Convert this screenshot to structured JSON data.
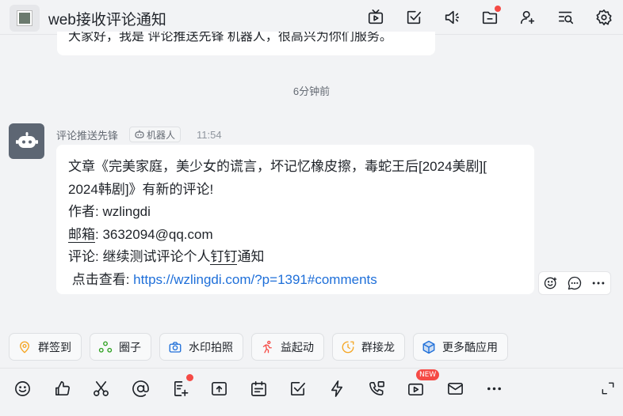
{
  "header": {
    "title": "web接收评论通知",
    "icons": [
      "live-icon",
      "todo-icon",
      "announce-icon",
      "folder-icon",
      "add-member-icon",
      "search-history-icon",
      "settings-icon"
    ]
  },
  "prev_message": {
    "text": "大家好，我是 评论推送先锋 机器人，很高兴为你们服务。"
  },
  "time_separator": "6分钟前",
  "message": {
    "sender": "评论推送先锋",
    "tag": "机器人",
    "time": "11:54",
    "line1": "文章《完美家庭，美少女的谎言，坏记忆橡皮擦，毒蛇王后[2024美剧][",
    "line2": "2024韩剧]》有新的评论!",
    "line3": "作者: wzlingdi",
    "line4_label": "邮箱",
    "line4_value": ": 3632094@qq.com",
    "line5_prefix": "评论: 继续测试评论个人",
    "line5_underlined": "钉钉",
    "line5_suffix": "通知",
    "line6_label": " 点击查看: ",
    "line6_link": "https://wzlingdi.com/?p=1391#comments"
  },
  "quick_apps": [
    {
      "label": "群签到",
      "icon": "checkin-icon",
      "color": "#f5a623"
    },
    {
      "label": "圈子",
      "icon": "circle-icon",
      "color": "#2ea121"
    },
    {
      "label": "水印拍照",
      "icon": "camera-icon",
      "color": "#1e6fd9"
    },
    {
      "label": "益起动",
      "icon": "run-icon",
      "color": "#f54a45"
    },
    {
      "label": "群接龙",
      "icon": "relay-icon",
      "color": "#f5a623"
    },
    {
      "label": "更多酷应用",
      "icon": "cube-icon",
      "color": "#1e6fd9"
    }
  ],
  "toolbar": {
    "new_badge": "NEW"
  }
}
